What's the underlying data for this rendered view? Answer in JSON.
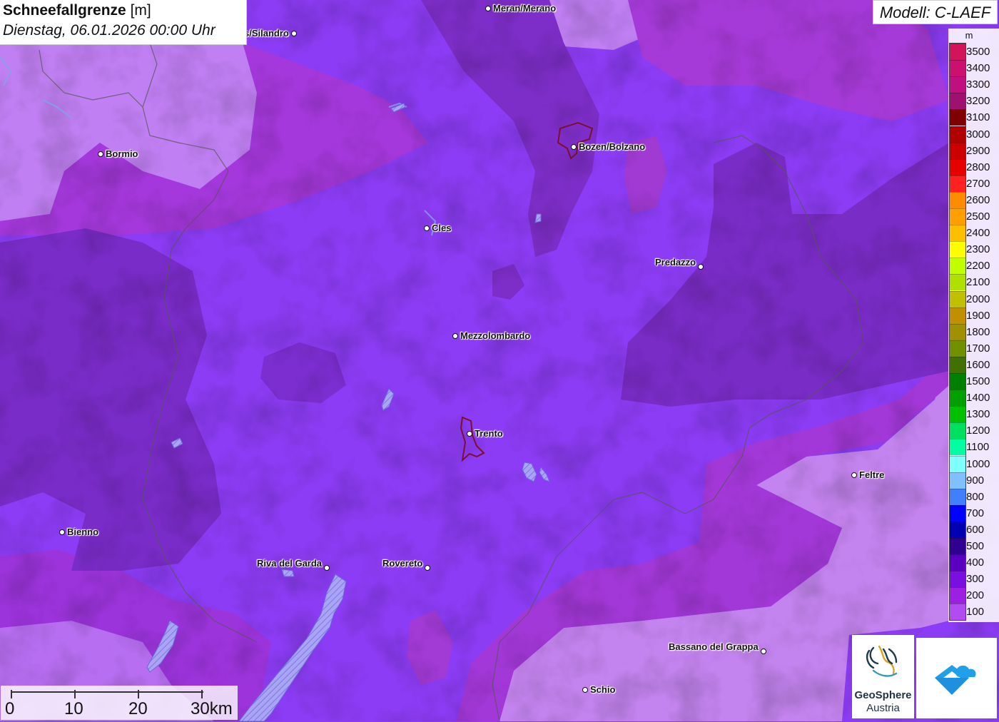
{
  "title": {
    "name": "Schneefallgrenze",
    "unit": "[m]",
    "date": "Dienstag, 06.01.2026 00:00 Uhr"
  },
  "model": "Modell: C-LAEF",
  "legend": {
    "unit": "m",
    "levels": [
      "3500",
      "3400",
      "3300",
      "3200",
      "3100",
      "3000",
      "2900",
      "2800",
      "2700",
      "2600",
      "2500",
      "2400",
      "2300",
      "2200",
      "2100",
      "2000",
      "1900",
      "1800",
      "1700",
      "1600",
      "1500",
      "1400",
      "1300",
      "1200",
      "1100",
      "1000",
      "900",
      "800",
      "700",
      "600",
      "500",
      "400",
      "300",
      "200",
      "100"
    ],
    "colors": [
      "#d4145a",
      "#cc1070",
      "#c01080",
      "#a0106e",
      "#800000",
      "#b00000",
      "#cc0000",
      "#e60000",
      "#ff2020",
      "#ff8c00",
      "#ffa000",
      "#ffbf00",
      "#ffff00",
      "#c0ff00",
      "#b0e000",
      "#c0c000",
      "#c09000",
      "#a09000",
      "#709000",
      "#407000",
      "#008000",
      "#00a000",
      "#00c000",
      "#00e060",
      "#00ffa0",
      "#80ffff",
      "#80c0ff",
      "#4080ff",
      "#0000ff",
      "#0000b0",
      "#300090",
      "#5a00c0",
      "#7a10e0",
      "#9c20e0",
      "#b04cf0"
    ]
  },
  "cities": [
    {
      "name": "Meran/Merano"
    },
    {
      "name": "s/Silandro"
    },
    {
      "name": "Bormio"
    },
    {
      "name": "Bozen/Bolzano"
    },
    {
      "name": "Cles"
    },
    {
      "name": "Predazzo"
    },
    {
      "name": "Mezzolombardo"
    },
    {
      "name": "Trento"
    },
    {
      "name": "Feltre"
    },
    {
      "name": "Bienno"
    },
    {
      "name": "Riva del Garda"
    },
    {
      "name": "Rovereto"
    },
    {
      "name": "Bassano del Grappa"
    },
    {
      "name": "Schio"
    }
  ],
  "scale": {
    "labels": [
      "0",
      "10",
      "20",
      "30km"
    ]
  },
  "logos": {
    "geosphere_line1": "GeoSphere",
    "geosphere_line2": "Austria"
  }
}
